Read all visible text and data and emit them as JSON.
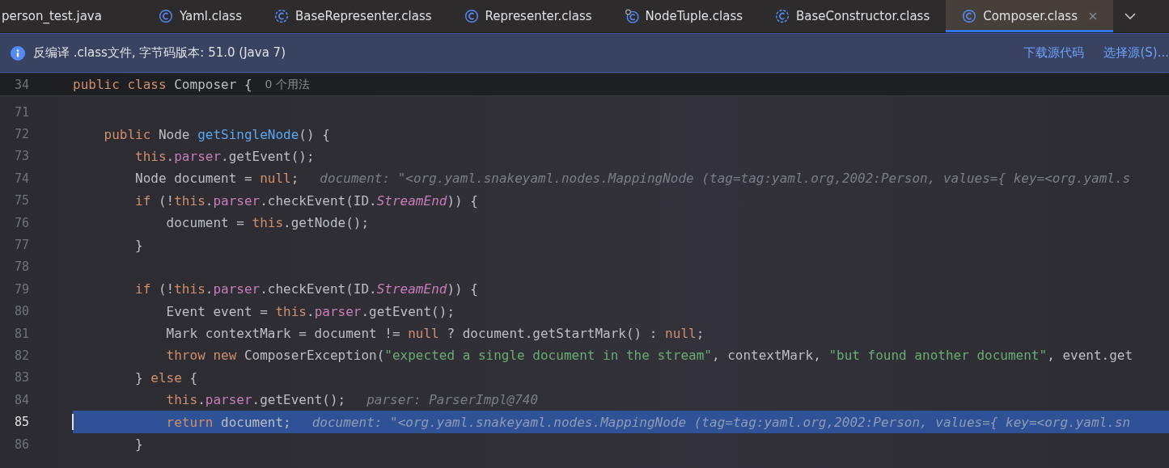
{
  "tabs": [
    {
      "label": "person_test.java",
      "kind": "file",
      "selected": false
    },
    {
      "label": "Yaml.class",
      "kind": "class",
      "selected": false
    },
    {
      "label": "BaseRepresenter.class",
      "kind": "abstract-class",
      "selected": false
    },
    {
      "label": "Representer.class",
      "kind": "class",
      "selected": false
    },
    {
      "label": "NodeTuple.class",
      "kind": "linked-class",
      "selected": false
    },
    {
      "label": "BaseConstructor.class",
      "kind": "abstract-class",
      "selected": false
    },
    {
      "label": "Composer.class",
      "kind": "class",
      "selected": true
    }
  ],
  "notice": {
    "text": "反编译 .class文件, 字节码版本: 51.0 (Java 7)",
    "links": [
      "下载源代码",
      "选择源(S)..."
    ]
  },
  "sticky_line": {
    "number": "34",
    "code": [
      {
        "text": "public class",
        "kind": "kw"
      },
      {
        "text": " Composer {",
        "kind": "plain"
      }
    ],
    "usages": "0 个用法"
  },
  "lines": [
    {
      "number": "71",
      "current": false
    },
    {
      "number": "72",
      "current": false,
      "code": [
        {
          "text": "    public",
          "kind": "kw"
        },
        {
          "text": " Node ",
          "kind": "plain"
        },
        {
          "text": "getSingleNode",
          "kind": "fn"
        },
        {
          "text": "() {",
          "kind": "plain"
        }
      ]
    },
    {
      "number": "73",
      "current": false,
      "code": [
        {
          "text": "        this",
          "kind": "kw"
        },
        {
          "text": ".",
          "kind": "plain"
        },
        {
          "text": "parser",
          "kind": "field"
        },
        {
          "text": ".getEvent();",
          "kind": "plain"
        }
      ]
    },
    {
      "number": "74",
      "current": false,
      "code": [
        {
          "text": "        Node document = ",
          "kind": "plain"
        },
        {
          "text": "null",
          "kind": "kw"
        },
        {
          "text": ";",
          "kind": "plain"
        }
      ],
      "hint": "document: \"<org.yaml.snakeyaml.nodes.MappingNode (tag=tag:yaml.org,2002:Person, values={ key=<org.yaml.s"
    },
    {
      "number": "75",
      "current": false,
      "code": [
        {
          "text": "        if",
          "kind": "kw"
        },
        {
          "text": " (!",
          "kind": "plain"
        },
        {
          "text": "this",
          "kind": "kw"
        },
        {
          "text": ".",
          "kind": "plain"
        },
        {
          "text": "parser",
          "kind": "field"
        },
        {
          "text": ".checkEvent(ID.",
          "kind": "plain"
        },
        {
          "text": "StreamEnd",
          "kind": "static"
        },
        {
          "text": ")) {",
          "kind": "plain"
        }
      ]
    },
    {
      "number": "76",
      "current": false,
      "code": [
        {
          "text": "            document = ",
          "kind": "plain"
        },
        {
          "text": "this",
          "kind": "kw"
        },
        {
          "text": ".getNode();",
          "kind": "plain"
        }
      ]
    },
    {
      "number": "77",
      "current": false,
      "code": [
        {
          "text": "        }",
          "kind": "plain"
        }
      ]
    },
    {
      "number": "78",
      "current": false
    },
    {
      "number": "79",
      "current": false,
      "code": [
        {
          "text": "        if",
          "kind": "kw"
        },
        {
          "text": " (!",
          "kind": "plain"
        },
        {
          "text": "this",
          "kind": "kw"
        },
        {
          "text": ".",
          "kind": "plain"
        },
        {
          "text": "parser",
          "kind": "field"
        },
        {
          "text": ".checkEvent(ID.",
          "kind": "plain"
        },
        {
          "text": "StreamEnd",
          "kind": "static"
        },
        {
          "text": ")) {",
          "kind": "plain"
        }
      ]
    },
    {
      "number": "80",
      "current": false,
      "code": [
        {
          "text": "            Event event = ",
          "kind": "plain"
        },
        {
          "text": "this",
          "kind": "kw"
        },
        {
          "text": ".",
          "kind": "plain"
        },
        {
          "text": "parser",
          "kind": "field"
        },
        {
          "text": ".getEvent();",
          "kind": "plain"
        }
      ]
    },
    {
      "number": "81",
      "current": false,
      "code": [
        {
          "text": "            Mark contextMark = document != ",
          "kind": "plain"
        },
        {
          "text": "null",
          "kind": "kw"
        },
        {
          "text": " ? document.getStartMark() : ",
          "kind": "plain"
        },
        {
          "text": "null",
          "kind": "kw"
        },
        {
          "text": ";",
          "kind": "plain"
        }
      ]
    },
    {
      "number": "82",
      "current": false,
      "code": [
        {
          "text": "            throw new",
          "kind": "kw"
        },
        {
          "text": " ComposerException(",
          "kind": "plain"
        },
        {
          "text": "\"expected a single document in the stream\"",
          "kind": "str"
        },
        {
          "text": ", contextMark, ",
          "kind": "plain"
        },
        {
          "text": "\"but found another document\"",
          "kind": "str"
        },
        {
          "text": ", event.get",
          "kind": "plain"
        }
      ]
    },
    {
      "number": "83",
      "current": false,
      "code": [
        {
          "text": "        } ",
          "kind": "plain"
        },
        {
          "text": "else",
          "kind": "kw"
        },
        {
          "text": " {",
          "kind": "plain"
        }
      ]
    },
    {
      "number": "84",
      "current": false,
      "code": [
        {
          "text": "            this",
          "kind": "kw"
        },
        {
          "text": ".",
          "kind": "plain"
        },
        {
          "text": "parser",
          "kind": "field"
        },
        {
          "text": ".getEvent();",
          "kind": "plain"
        }
      ],
      "hint": "parser: ParserImpl@740"
    },
    {
      "number": "85",
      "current": true,
      "code": [
        {
          "text": "            return",
          "kind": "kw"
        },
        {
          "text": " document;",
          "kind": "plain"
        }
      ],
      "hint": "document: \"<org.yaml.snakeyaml.nodes.MappingNode (tag=tag:yaml.org,2002:Person, values={ key=<org.yaml.sn"
    },
    {
      "number": "86",
      "current": false,
      "code": [
        {
          "text": "        }",
          "kind": "plain"
        }
      ]
    }
  ]
}
